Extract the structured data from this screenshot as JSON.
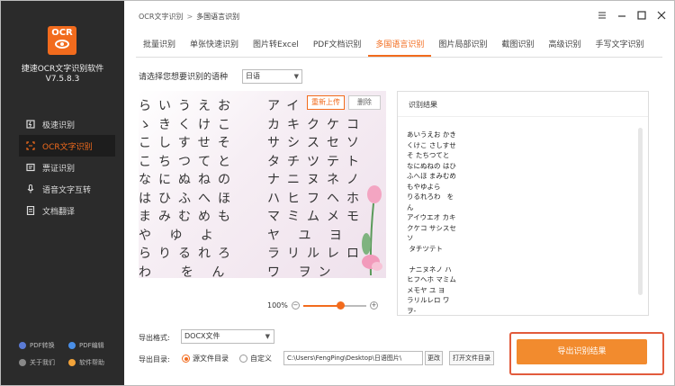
{
  "sidebar": {
    "logo_text": "OCR",
    "app_name": "捷速OCR文字识别软件",
    "app_version": "V7.5.8.3",
    "nav": [
      {
        "label": "极速识别",
        "icon": "lightning-icon",
        "active": false
      },
      {
        "label": "OCR文字识别",
        "icon": "ocr-scan-icon",
        "active": true
      },
      {
        "label": "票证识别",
        "icon": "ticket-icon",
        "active": false
      },
      {
        "label": "语音文字互转",
        "icon": "microphone-icon",
        "active": false
      },
      {
        "label": "文档翻译",
        "icon": "document-icon",
        "active": false
      }
    ],
    "bottom_links": [
      {
        "label": "PDF转换",
        "icon": "pdf-convert-icon",
        "color": "#5b7bd5"
      },
      {
        "label": "PDF编辑",
        "icon": "pdf-edit-icon",
        "color": "#4a8fe7"
      },
      {
        "label": "关于我们",
        "icon": "info-icon",
        "color": "#888888"
      },
      {
        "label": "软件帮助",
        "icon": "help-icon",
        "color": "#f2a33a"
      }
    ]
  },
  "titlebar": {
    "crumb_root": "OCR文字识别",
    "crumb_sep": ">",
    "crumb_current": "多国语言识别",
    "controls": [
      "list-icon",
      "minimize-icon",
      "maximize-icon",
      "close-icon"
    ]
  },
  "tabs": [
    {
      "label": "批量识别",
      "active": false
    },
    {
      "label": "单张快速识别",
      "active": false
    },
    {
      "label": "图片转Excel",
      "active": false
    },
    {
      "label": "PDF文档识别",
      "active": false
    },
    {
      "label": "多国语言识别",
      "active": true
    },
    {
      "label": "图片局部识别",
      "active": false
    },
    {
      "label": "截图识别",
      "active": false
    },
    {
      "label": "高级识别",
      "active": false
    },
    {
      "label": "手写文字识别",
      "active": false
    }
  ],
  "language": {
    "label": "请选择您想要识别的语种",
    "selected": "日语"
  },
  "preview": {
    "reupload_label": "重新上传",
    "delete_label": "删除",
    "hiragana_rows": [
      "らいうえお",
      "ゝきくけこ",
      "こしすせそ",
      "こちつてと",
      "なにぬねの",
      "はひふへほ",
      "まみむめも",
      "や ゆ よ",
      "らりるれろ",
      "わ  を ん"
    ],
    "katakana_rows": [
      "アイ",
      "カキクケコ",
      "サシスセソ",
      "タチツテト",
      "ナニヌネノ",
      "ハヒフヘホ",
      "マミムメモ",
      "ヤ ユ ヨ",
      "ラリルレロ",
      "ワ ヲン"
    ],
    "zoom_value": "100%",
    "zoom_fraction": 0.6
  },
  "result": {
    "title": "识别结果",
    "text": "あいうえお かき\nくけこ さしすせ\nそ たちつてと\nなにぬねの はひ\nふへほ まみむめ\nもやゆよら\nりるれろわ   を\nん\nアイウエオ カキ\nクケコ サシスセ\nソ\n タチツテト\n\n ナニヌネノ ハ\nヒフヘホ マミム\nメモヤ ユ ヨ\nラリルレロ ワ\nヲ-"
  },
  "export": {
    "format_label": "导出格式:",
    "format_value": "DOCX文件",
    "dir_label": "导出目录:",
    "radio_source": "源文件目录",
    "radio_custom": "自定义",
    "path_value": "C:\\Users\\FengPing\\Desktop\\日语图片\\",
    "change_label": "更改",
    "open_label": "打开文件目录",
    "export_button": "导出识别结果"
  }
}
